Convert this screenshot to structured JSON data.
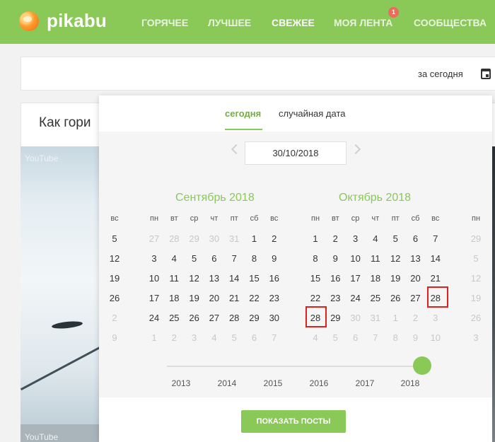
{
  "header": {
    "logo_text": "pikabu",
    "nav": [
      {
        "label": "ГОРЯЧЕЕ"
      },
      {
        "label": "ЛУЧШЕЕ"
      },
      {
        "label": "СВЕЖЕЕ",
        "active": true
      },
      {
        "label": "МОЯ ЛЕНТА",
        "badge": "1"
      },
      {
        "label": "СООБЩЕСТВА"
      }
    ],
    "accent": "#8ac858"
  },
  "filter": {
    "date_label": "за сегодня",
    "icon": "calendar-icon"
  },
  "post": {
    "title_partial": "Как гори",
    "video_label_top": "YouTube",
    "video_label_bottom": "YouTube"
  },
  "datepicker": {
    "tabs": [
      {
        "label": "сегодня",
        "active": true
      },
      {
        "label": "случайная дата"
      }
    ],
    "date_value": "30/10/2018",
    "weekday_headers": [
      "пн",
      "вт",
      "ср",
      "чт",
      "пт",
      "сб",
      "вс"
    ],
    "months": [
      {
        "title": "Сентябрь 2018",
        "rows": [
          [
            "27",
            "28",
            "29",
            "30",
            "31",
            "1",
            "2"
          ],
          [
            "3",
            "4",
            "5",
            "6",
            "7",
            "8",
            "9"
          ],
          [
            "10",
            "11",
            "12",
            "13",
            "14",
            "15",
            "16"
          ],
          [
            "17",
            "18",
            "19",
            "20",
            "21",
            "22",
            "23"
          ],
          [
            "24",
            "25",
            "26",
            "27",
            "28",
            "29",
            "30"
          ],
          [
            "1",
            "2",
            "3",
            "4",
            "5",
            "6",
            "7"
          ]
        ],
        "muted": [
          [
            true,
            true,
            true,
            true,
            true,
            false,
            false
          ],
          [
            false,
            false,
            false,
            false,
            false,
            false,
            false
          ],
          [
            false,
            false,
            false,
            false,
            false,
            false,
            false
          ],
          [
            false,
            false,
            false,
            false,
            false,
            false,
            false
          ],
          [
            false,
            false,
            false,
            false,
            false,
            false,
            false
          ],
          [
            true,
            true,
            true,
            true,
            true,
            true,
            true
          ]
        ]
      },
      {
        "title": "Октябрь 2018",
        "rows": [
          [
            "1",
            "2",
            "3",
            "4",
            "5",
            "6",
            "7"
          ],
          [
            "8",
            "9",
            "10",
            "11",
            "12",
            "13",
            "14"
          ],
          [
            "15",
            "16",
            "17",
            "18",
            "19",
            "20",
            "21"
          ],
          [
            "22",
            "23",
            "24",
            "25",
            "26",
            "27",
            "28"
          ],
          [
            "28",
            "29",
            "30",
            "31",
            "1",
            "2",
            "3"
          ],
          [
            "4",
            "5",
            "6",
            "7",
            "8",
            "9",
            "10"
          ]
        ],
        "muted": [
          [
            false,
            false,
            false,
            false,
            false,
            false,
            false
          ],
          [
            false,
            false,
            false,
            false,
            false,
            false,
            false
          ],
          [
            false,
            false,
            false,
            false,
            false,
            false,
            false
          ],
          [
            false,
            false,
            false,
            false,
            false,
            false,
            false
          ],
          [
            false,
            false,
            true,
            true,
            true,
            true,
            true
          ],
          [
            true,
            true,
            true,
            true,
            true,
            true,
            true
          ]
        ]
      }
    ],
    "left_partial_column": [
      "вс",
      "5",
      "12",
      "19",
      "26",
      "2",
      "9"
    ],
    "right_partial_column": [
      "пн",
      "29",
      "5",
      "12",
      "19",
      "26",
      "3"
    ],
    "highlighted_days": [
      "28",
      "28"
    ],
    "years": [
      "2013",
      "2014",
      "2015",
      "2016",
      "2017",
      "2018"
    ],
    "selected_year": "2018",
    "show_button": "ПОКАЗАТЬ ПОСТЫ"
  }
}
